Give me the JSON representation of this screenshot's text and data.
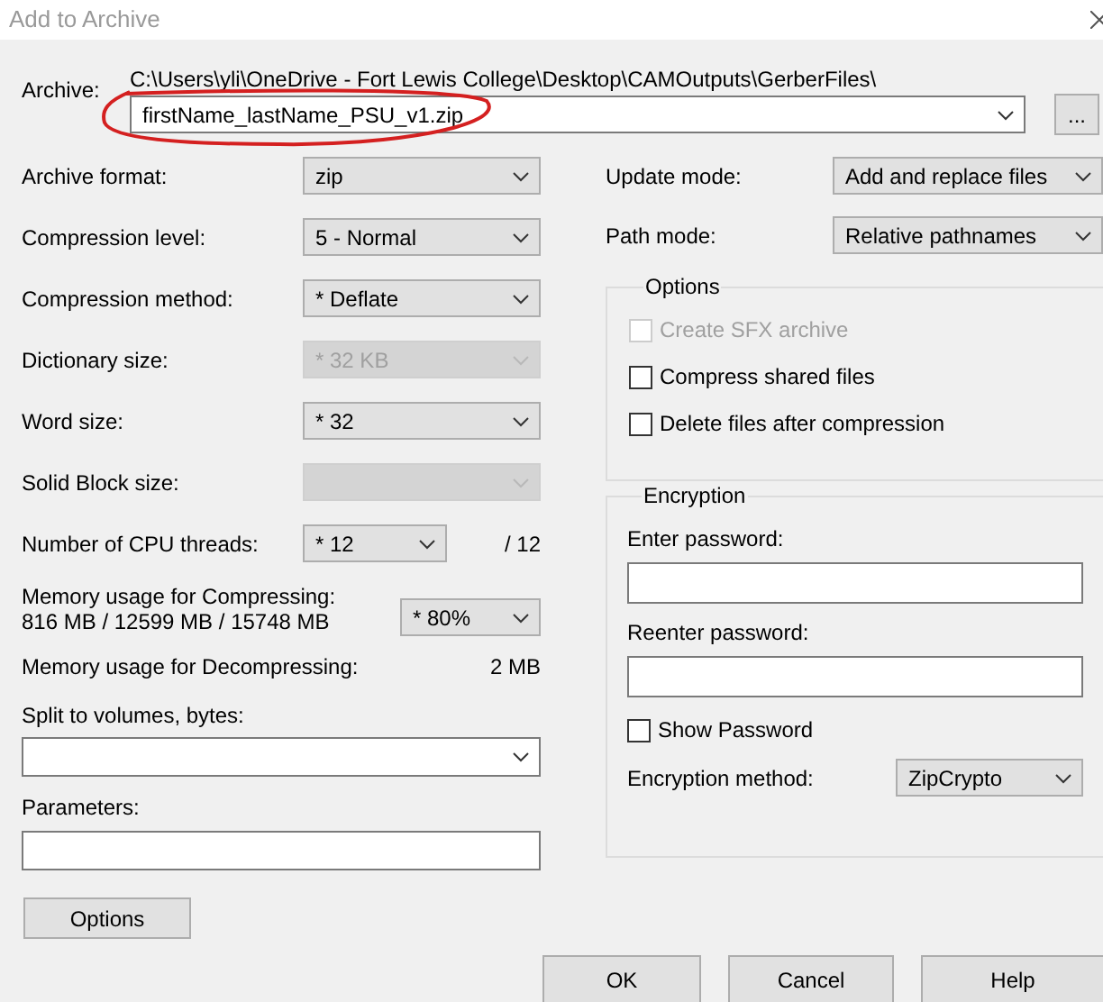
{
  "window": {
    "title": "Add to Archive"
  },
  "archive": {
    "label": "Archive:",
    "path": "C:\\Users\\yli\\OneDrive - Fort Lewis College\\Desktop\\CAMOutputs\\GerberFiles\\",
    "filename": "firstName_lastName_PSU_v1.zip",
    "browse_button": "..."
  },
  "annotation": {
    "kind": "ellipse"
  },
  "settings": [
    {
      "kind": "select",
      "label": "Archive format:",
      "value": "zip",
      "disabled": false
    },
    {
      "kind": "select",
      "label": "Compression level:",
      "value": "5 - Normal",
      "disabled": false
    },
    {
      "kind": "select",
      "label": "Compression method:",
      "value": "* Deflate",
      "disabled": false
    },
    {
      "kind": "select",
      "label": "Dictionary size:",
      "value": "* 32 KB",
      "disabled": true
    },
    {
      "kind": "select",
      "label": "Word size:",
      "value": "* 32",
      "disabled": false
    },
    {
      "kind": "select",
      "label": "Solid Block size:",
      "disabled": true
    },
    {
      "kind": "threads",
      "label": "Number of CPU threads:",
      "value": "* 12",
      "suffix": "/ 12",
      "disabled": false
    },
    {
      "kind": "memory",
      "label": "Memory usage for Compressing:",
      "detail": "816 MB / 12599 MB / 15748 MB",
      "value": "* 80%",
      "disabled": false
    },
    {
      "kind": "readout",
      "label": "Memory usage for Decompressing:",
      "value": "2 MB"
    }
  ],
  "split": {
    "label": "Split to volumes, bytes:"
  },
  "parameters": {
    "label": "Parameters:"
  },
  "options_button": "Options",
  "update_mode": {
    "label": "Update mode:",
    "value": "Add and replace files"
  },
  "path_mode": {
    "label": "Path mode:",
    "value": "Relative pathnames"
  },
  "options_group": {
    "title": "Options",
    "items": [
      {
        "label": "Create SFX archive",
        "checked": false,
        "disabled": true
      },
      {
        "label": "Compress shared files",
        "checked": false,
        "disabled": false
      },
      {
        "label": "Delete files after compression",
        "checked": false,
        "disabled": false
      }
    ]
  },
  "encryption": {
    "title": "Encryption",
    "enter_label": "Enter password:",
    "reenter_label": "Reenter password:",
    "show_password": {
      "label": "Show Password",
      "checked": false
    },
    "method_label": "Encryption method:",
    "method_value": "ZipCrypto"
  },
  "buttons": [
    "OK",
    "Cancel",
    "Help"
  ]
}
